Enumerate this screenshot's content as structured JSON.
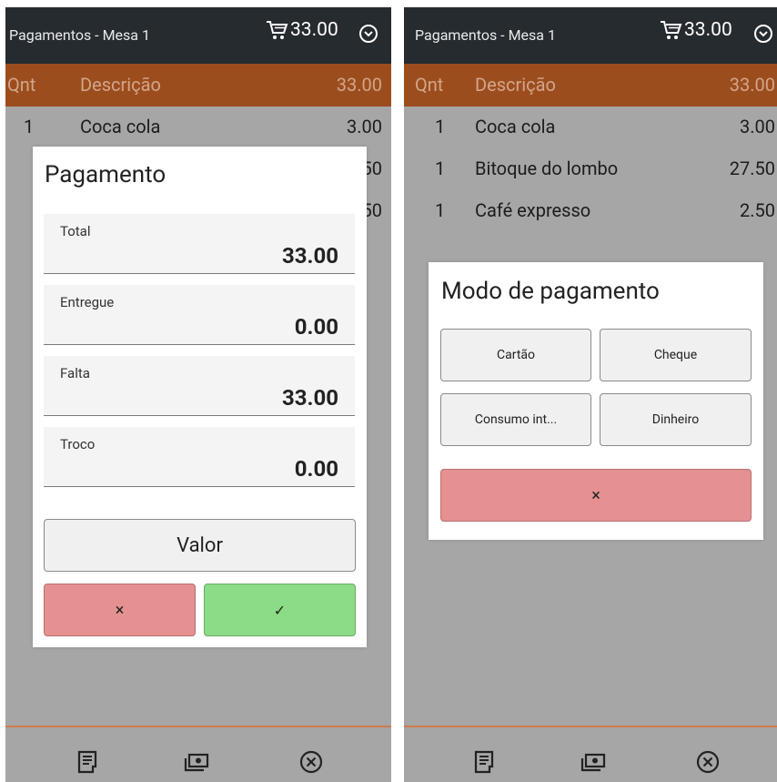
{
  "left": {
    "topbar": {
      "title": "Pagamentos - Mesa 1",
      "total": "33.00"
    },
    "header": {
      "qnt": "Qnt",
      "descricao": "Descrição",
      "total": "33.00"
    },
    "rows": [
      {
        "qty": "1",
        "desc": "Coca cola",
        "price": "3.00"
      }
    ],
    "partial_prices": [
      "50",
      "50"
    ],
    "dialog": {
      "title": "Pagamento",
      "fields": [
        {
          "label": "Total",
          "value": "33.00"
        },
        {
          "label": "Entregue",
          "value": "0.00"
        },
        {
          "label": "Falta",
          "value": "33.00"
        },
        {
          "label": "Troco",
          "value": "0.00"
        }
      ],
      "valor_label": "Valor",
      "cancel_label": "×",
      "confirm_label": "✓"
    }
  },
  "right": {
    "topbar": {
      "title": "Pagamentos - Mesa 1",
      "total": "33.00"
    },
    "header": {
      "qnt": "Qnt",
      "descricao": "Descrição",
      "total": "33.00"
    },
    "rows": [
      {
        "qty": "1",
        "desc": "Coca cola",
        "price": "3.00"
      },
      {
        "qty": "1",
        "desc": "Bitoque do lombo",
        "price": "27.50"
      },
      {
        "qty": "1",
        "desc": "Café expresso",
        "price": "2.50"
      }
    ],
    "dialog": {
      "title": "Modo de pagamento",
      "options": [
        "Cartão",
        "Cheque",
        "Consumo int...",
        "Dinheiro"
      ],
      "cancel_label": "×"
    }
  },
  "icons": [
    "cart-icon",
    "chevron-down-circle-icon",
    "receipt-icon",
    "money-icon",
    "close-circle-icon"
  ],
  "colors": {
    "topbar": "#262b30",
    "header": "#9c4d1e",
    "overlay": "#a6a6a6",
    "cancel": "#e59191",
    "confirm": "#8cdb86"
  }
}
